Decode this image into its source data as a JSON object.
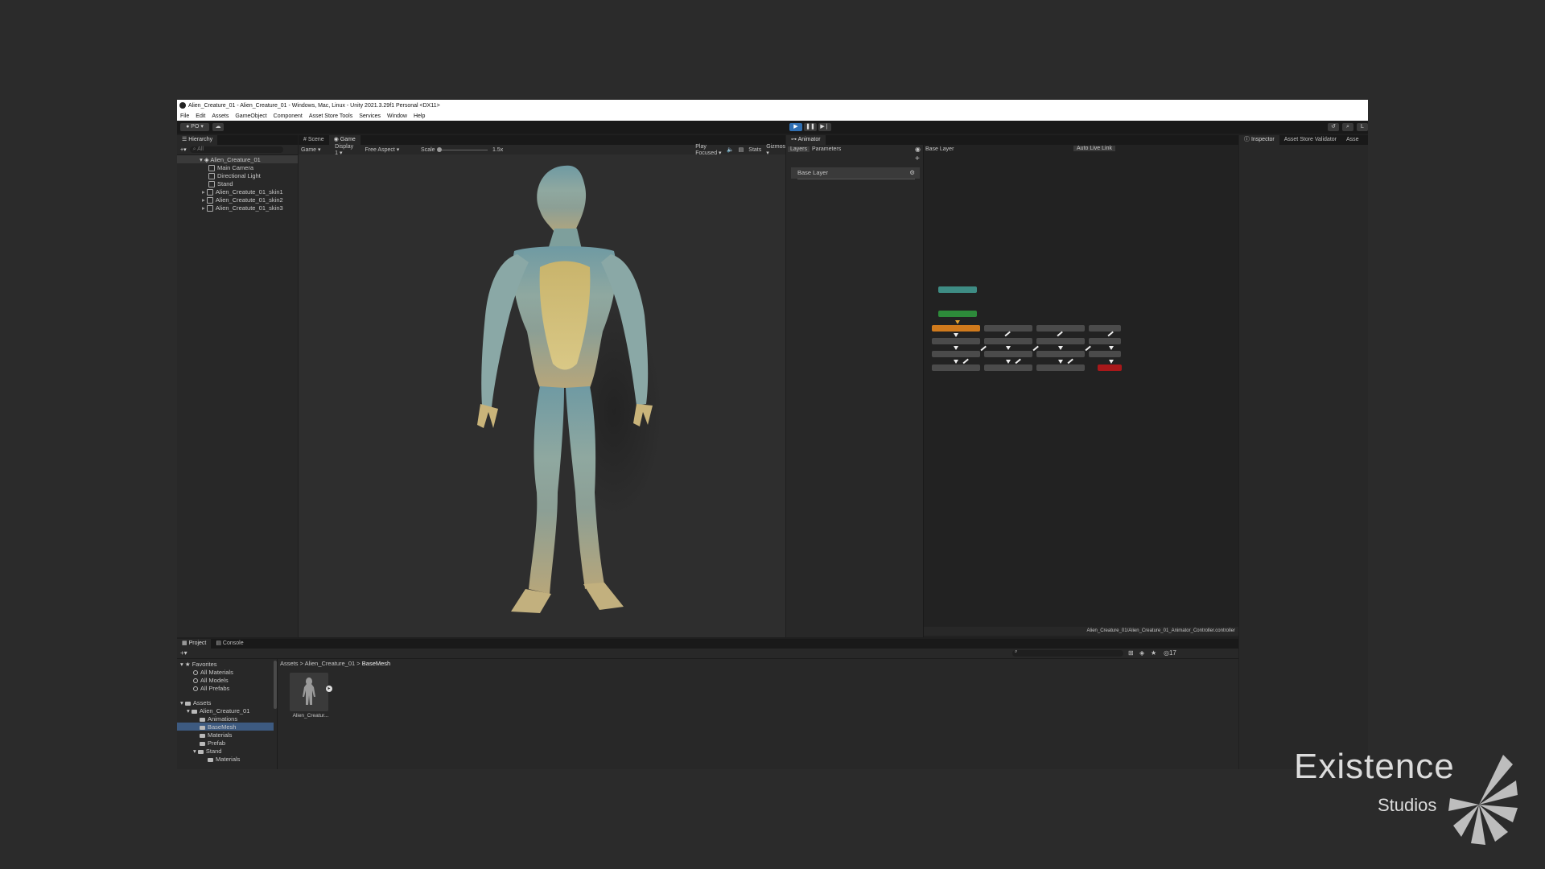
{
  "window": {
    "title": "Alien_Creature_01 - Alien_Creature_01 - Windows, Mac, Linux - Unity 2021.3.29f1 Personal <DX11>"
  },
  "menubar": [
    "File",
    "Edit",
    "Assets",
    "GameObject",
    "Component",
    "Asset Store Tools",
    "Services",
    "Window",
    "Help"
  ],
  "toolbar": {
    "account": "PO",
    "play_icon": "play-icon",
    "pause_icon": "pause-icon",
    "step_icon": "step-icon"
  },
  "hierarchy": {
    "tab": "Hierarchy",
    "search_placeholder": "All",
    "scene": "Alien_Creature_01",
    "items": [
      "Main Camera",
      "Directional Light",
      "Stand",
      "Alien_Creatute_01_skin1",
      "Alien_Creatute_01_skin2",
      "Alien_Creatute_01_skin3"
    ]
  },
  "game": {
    "tabs": [
      "Scene",
      "Game"
    ],
    "mode": "Game",
    "display": "Display 1",
    "aspect": "Free Aspect",
    "scale_label": "Scale",
    "scale_value": "1.5x",
    "play_focused": "Play Focused",
    "stats": "Stats",
    "gizmos": "Gizmos"
  },
  "animator": {
    "tab": "Animator",
    "subtabs": [
      "Layers",
      "Parameters"
    ],
    "breadcrumb": "Base Layer",
    "layer": "Base Layer",
    "auto_live_link": "Auto Live Link",
    "footer_path": "Alien_Creature_01/Alien_Creature_01_Animator_Controller.controller"
  },
  "inspector": {
    "tabs": [
      "Inspector",
      "Asset Store Validator",
      "Asse"
    ]
  },
  "project": {
    "tabs": [
      "Project",
      "Console"
    ],
    "favorites_label": "Favorites",
    "favorites": [
      "All Materials",
      "All Models",
      "All Prefabs"
    ],
    "assets_label": "Assets",
    "tree": [
      "Alien_Creature_01",
      "Animations",
      "BaseMesh",
      "Materials",
      "Prefab",
      "Stand",
      "Materials"
    ],
    "breadcrumb": [
      "Assets",
      "Alien_Creature_01",
      "BaseMesh"
    ],
    "asset_name": "Alien_Creatur...",
    "hidden_count": "17"
  },
  "watermark": {
    "brand": "Existence",
    "sub": "Studios"
  }
}
